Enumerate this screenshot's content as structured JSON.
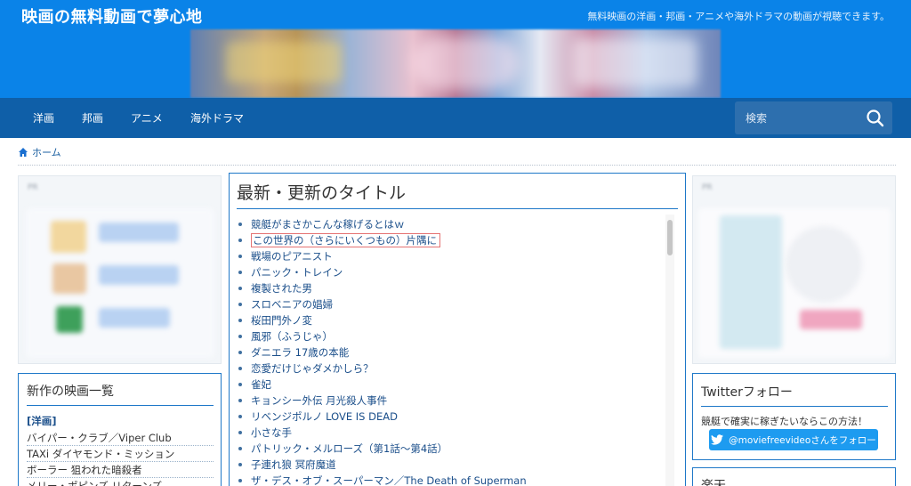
{
  "header": {
    "site_title": "映画の無料動画で夢心地",
    "site_description": "無料映画の洋画・邦画・アニメや海外ドラマの動画が視聴できます。"
  },
  "nav": {
    "items": [
      "洋画",
      "邦画",
      "アニメ",
      "海外ドラマ"
    ],
    "search_placeholder": "検索"
  },
  "breadcrumb": {
    "home_label": "ホーム"
  },
  "main": {
    "title": "最新・更新のタイトル",
    "items": [
      "競艇がまさかこんな稼げるとはｗ",
      "この世界の（さらにいくつもの）片隅に",
      "戦場のピアニスト",
      "パニック・トレイン",
      "複製された男",
      "スロベニアの娼婦",
      "桜田門外ノ変",
      "風邪（ふうじゃ）",
      "ダニエラ 17歳の本能",
      "恋愛だけじゃダメかしら？",
      "雀妃",
      "キョンシー外伝 月光殺人事件",
      "リベンジポルノ LOVE IS DEAD",
      "小さな手",
      "パトリック・メルローズ（第1話～第4話）",
      "子連れ狼 冥府魔道",
      "ザ・デス・オブ・スーパーマン／The Death of Superman"
    ]
  },
  "left_panel": {
    "title": "新作の映画一覧",
    "category": "[洋画]",
    "items": [
      "バイパー・クラブ／Viper Club",
      "TAXi ダイヤモンド・ミッション",
      "ボーラー 狙われた暗殺者",
      "メリー・ポピンズ リターンズ"
    ]
  },
  "twitter_panel": {
    "title": "Twitterフォロー",
    "text": "競艇で確実に稼ぎたいならこの方法！",
    "button_label": "@moviefreevideoさんをフォロー"
  },
  "rakuten_panel": {
    "title": "楽天"
  },
  "ads": {
    "label": "PR"
  },
  "colors": {
    "header_bg": "#0a83e8",
    "nav_bg": "#0f5fa8",
    "accent": "#1e78c8",
    "twitter": "#1d9bf0"
  }
}
